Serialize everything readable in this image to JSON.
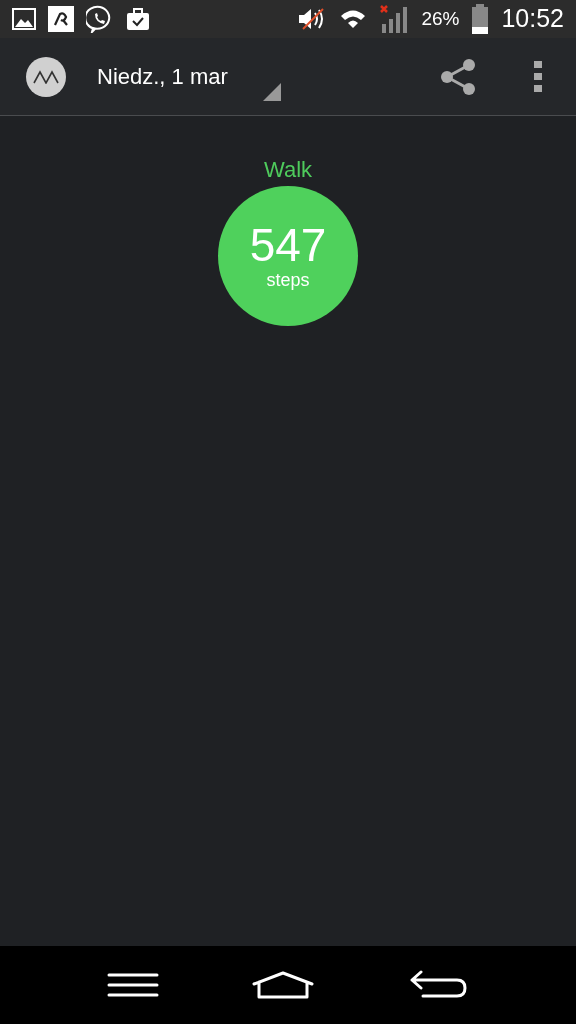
{
  "status_bar": {
    "battery": "26%",
    "time": "10:52"
  },
  "app_bar": {
    "date": "Niedz., 1 mar"
  },
  "activity": {
    "label": "Walk",
    "value": "547",
    "unit": "steps"
  }
}
